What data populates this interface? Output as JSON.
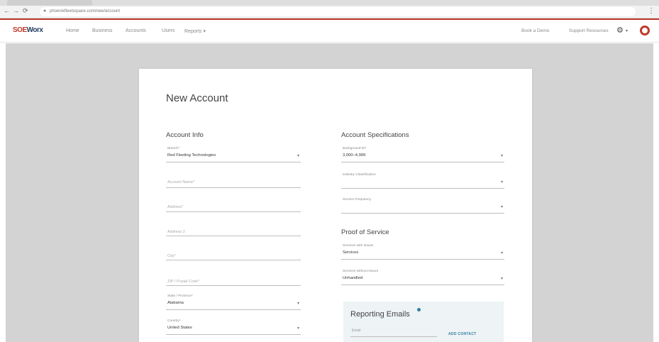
{
  "browser": {
    "url": "phoenixfleetsquare.com/new/account",
    "back_glyph": "←",
    "forward_glyph": "→",
    "reload_glyph": "⟳",
    "lock_glyph": "●",
    "menu_glyph": "⋮"
  },
  "header": {
    "logo_main": "SOE",
    "logo_sub": "Worx",
    "nav": [
      "Home",
      "Business",
      "Accounts",
      "Users",
      "Reports ▾"
    ],
    "right_links": [
      "Book a Demo",
      "Support Resources"
    ],
    "gear_glyph": "⚙",
    "caret_glyph": "▾"
  },
  "card": {
    "title": "New Account",
    "account_info": {
      "title": "Account Info",
      "branch": {
        "label": "Branch*",
        "value": "Red Fleeting Technologies"
      },
      "account_name": {
        "placeholder": "Account Name*"
      },
      "address": {
        "placeholder": "Address*"
      },
      "address2": {
        "placeholder": "Address 2"
      },
      "city": {
        "placeholder": "City*"
      },
      "zip": {
        "placeholder": "ZIP / Postal Code*"
      },
      "state": {
        "label": "State / Province*",
        "value": "Alabama"
      },
      "country": {
        "label": "Country*",
        "value": "United States"
      }
    },
    "specs": {
      "title": "Account Specifications",
      "background": {
        "label": "Background ID*",
        "value": "3,000–4,999"
      },
      "classification": {
        "label": "Industry Classification",
        "value": ""
      },
      "provider": {
        "label": "Service Frequency",
        "value": ""
      }
    },
    "proof": {
      "title": "Proof of Service",
      "with_issues": {
        "label": "Services with Issues",
        "value": "Services"
      },
      "without_issues": {
        "label": "Services without Issues",
        "value": "Unhandled"
      }
    },
    "emails": {
      "title": "Reporting Emails",
      "email_label": "Email",
      "add_contact": "ADD CONTACT"
    }
  },
  "colors": {
    "brand_red": "#c0392b",
    "accent_blue": "#2f7fa5",
    "page_bg": "#d3d3d3"
  }
}
